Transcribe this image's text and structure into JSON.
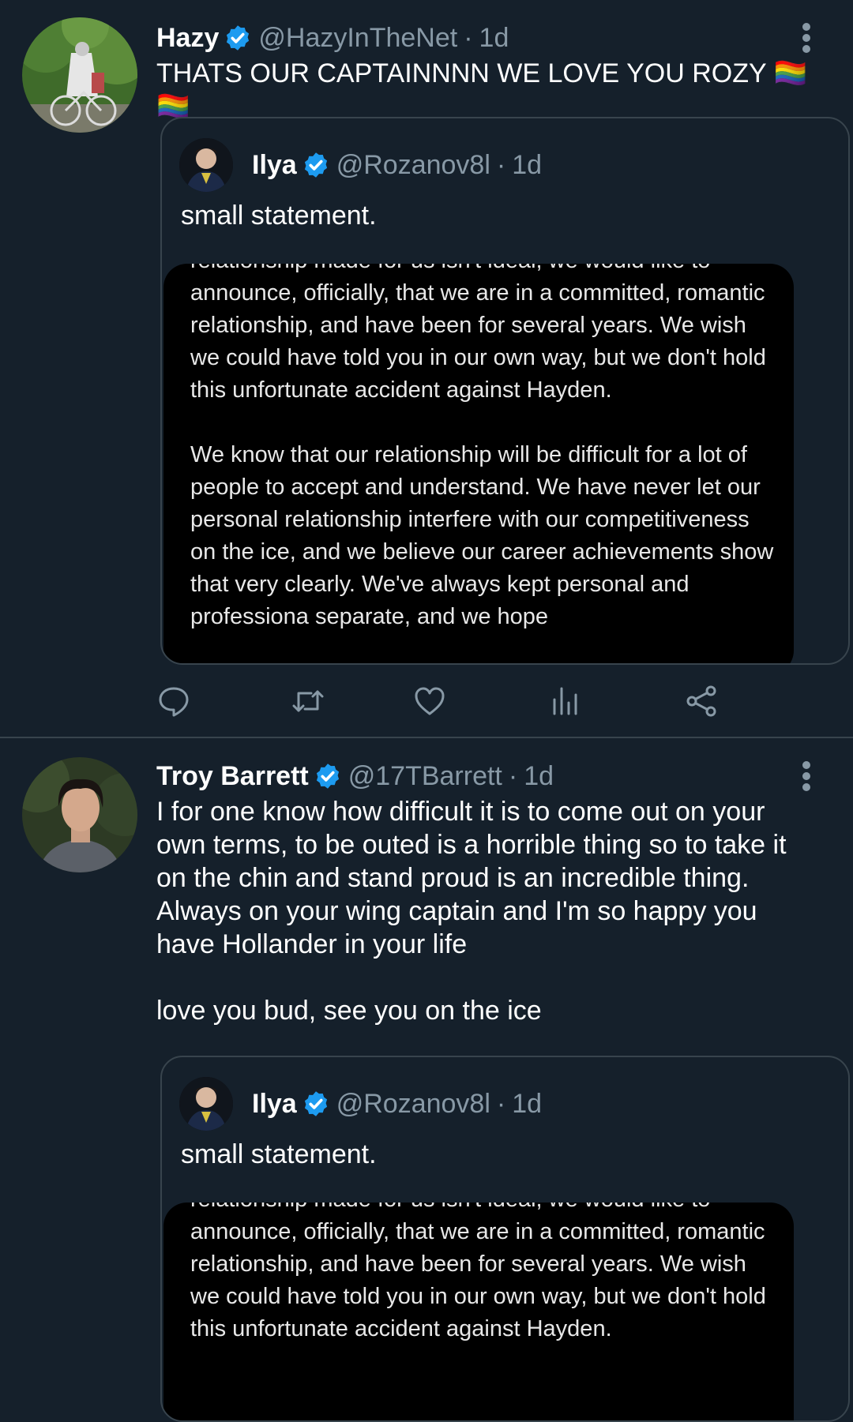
{
  "tweets": [
    {
      "author_name": "Hazy",
      "handle": "@HazyInTheNet",
      "time": "1d",
      "text": "THATS OUR CAPTAINNNN WE LOVE YOU ROZY 🏳️‍🌈🏳️‍🌈",
      "quote": {
        "author_name": "Ilya",
        "handle": "@Rozanov8l",
        "time": "1d",
        "text": "small statement.",
        "image_text": [
          "relationship made for us isn't ideal, we would like to announce, officially, that we are in a committed, romantic relationship, and have been for several years. We wish we could have told you in our own way, but we don't hold this unfortunate accident against Hayden.",
          "We know that our relationship will be difficult for a lot of people to accept and understand. We have never let our personal relationship interfere with our competitiveness on the ice, and we believe our career achievements show that very clearly. We've always kept personal and professiona separate, and we hope"
        ]
      }
    },
    {
      "author_name": "Troy Barrett",
      "handle": "@17TBarrett",
      "time": "1d",
      "text": "I for one know how difficult it is to come out on your own terms, to be outed is a horrible thing so to take it on the chin and stand proud is an incredible thing. Always on your wing captain and I'm so happy you have Hollander in your life",
      "text2": "love you bud, see you on the ice",
      "quote": {
        "author_name": "Ilya",
        "handle": "@Rozanov8l",
        "time": "1d",
        "text": "small statement.",
        "image_text": [
          "relationship made for us isn't ideal, we would like to announce, officially, that we are in a committed, romantic relationship, and have been for several years. We wish we could have told you in our own way, but we don't hold this unfortunate accident against Hayden."
        ]
      }
    }
  ],
  "separator": "·",
  "icons": [
    "verified-badge-icon",
    "more-vertical-icon",
    "reply-icon",
    "retweet-icon",
    "like-icon",
    "analytics-icon",
    "share-icon"
  ],
  "colors": {
    "background": "#15202b",
    "secondary_text": "#8899a6",
    "verified": "#1d9bf0",
    "border": "#38444d"
  }
}
